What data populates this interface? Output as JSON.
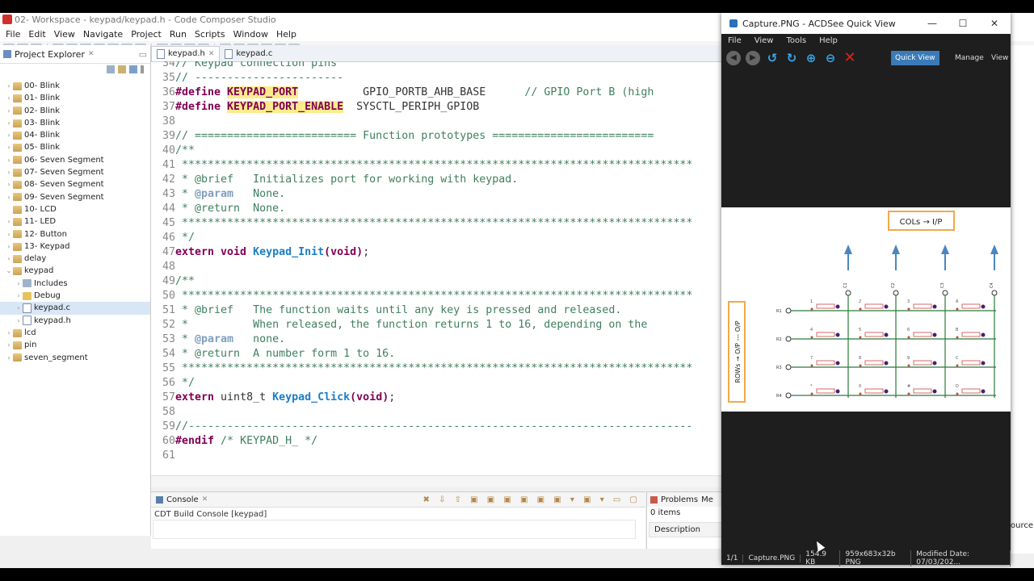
{
  "ccs": {
    "title": "02- Workspace - keypad/keypad.h - Code Composer Studio",
    "menu": [
      "File",
      "Edit",
      "View",
      "Navigate",
      "Project",
      "Run",
      "Scripts",
      "Window",
      "Help"
    ]
  },
  "project_explorer": {
    "title": "Project Explorer",
    "items": [
      {
        "label": "00- Blink",
        "kind": "proj",
        "indent": 0,
        "arrow": ">"
      },
      {
        "label": "01- Blink",
        "kind": "proj",
        "indent": 0,
        "arrow": ">"
      },
      {
        "label": "02- Blink",
        "kind": "proj",
        "indent": 0,
        "arrow": ">"
      },
      {
        "label": "03- Blink",
        "kind": "proj",
        "indent": 0,
        "arrow": ">"
      },
      {
        "label": "04- Blink",
        "kind": "proj",
        "indent": 0,
        "arrow": ">"
      },
      {
        "label": "05- Blink",
        "kind": "proj",
        "indent": 0,
        "arrow": ">"
      },
      {
        "label": "06- Seven Segment",
        "kind": "proj",
        "indent": 0,
        "arrow": ">"
      },
      {
        "label": "07- Seven Segment",
        "kind": "proj",
        "indent": 0,
        "arrow": ">"
      },
      {
        "label": "08- Seven Segment",
        "kind": "proj",
        "indent": 0,
        "arrow": ">"
      },
      {
        "label": "09- Seven Segment",
        "kind": "proj",
        "indent": 0,
        "arrow": ">"
      },
      {
        "label": "10- LCD",
        "kind": "proj",
        "indent": 0,
        "arrow": ""
      },
      {
        "label": "11- LED",
        "kind": "proj",
        "indent": 0,
        "arrow": ">"
      },
      {
        "label": "12- Button",
        "kind": "proj",
        "indent": 0,
        "arrow": ">"
      },
      {
        "label": "13- Keypad",
        "kind": "proj",
        "indent": 0,
        "arrow": ">"
      },
      {
        "label": "delay",
        "kind": "proj",
        "indent": 0,
        "arrow": ">"
      },
      {
        "label": "keypad",
        "kind": "proj",
        "indent": 0,
        "arrow": "v"
      },
      {
        "label": "Includes",
        "kind": "inc",
        "indent": 1,
        "arrow": ">"
      },
      {
        "label": "Debug",
        "kind": "folder",
        "indent": 1,
        "arrow": ">"
      },
      {
        "label": "keypad.c",
        "kind": "file",
        "indent": 1,
        "arrow": ">",
        "selected": true
      },
      {
        "label": "keypad.h",
        "kind": "file",
        "indent": 1,
        "arrow": ">"
      },
      {
        "label": "lcd",
        "kind": "proj",
        "indent": 0,
        "arrow": ">"
      },
      {
        "label": "pin",
        "kind": "proj",
        "indent": 0,
        "arrow": ">"
      },
      {
        "label": "seven_segment",
        "kind": "proj",
        "indent": 0,
        "arrow": ">"
      }
    ]
  },
  "editor": {
    "tabs": [
      {
        "label": "keypad.h",
        "active": true
      },
      {
        "label": "keypad.c",
        "active": false
      }
    ]
  },
  "console": {
    "title": "Console",
    "subtitle": "CDT Build Console [keypad]"
  },
  "problems": {
    "title": "Problems",
    "extra": "Me",
    "items": "0 items",
    "column": "Description"
  },
  "right_edge": {
    "text": "ource"
  },
  "acdsee": {
    "title": "Capture.PNG - ACDSee Quick View",
    "menu": [
      "File",
      "View",
      "Tools",
      "Help"
    ],
    "modes": [
      "Quick View",
      "Manage",
      "View"
    ],
    "image": {
      "cols_label": "COLs → I/P",
      "rows_label": "ROWs → O/P --- O/P",
      "row_names": [
        "R1",
        "R2",
        "R3",
        "R4"
      ],
      "col_names": [
        "C1",
        "C2",
        "C3",
        "C4"
      ],
      "keys": [
        "1",
        "2",
        "3",
        "A",
        "4",
        "5",
        "6",
        "B",
        "7",
        "8",
        "9",
        "C",
        "*",
        "0",
        "#",
        "D"
      ]
    },
    "status": [
      "1/1",
      "Capture.PNG",
      "154.9 KB",
      "959x683x32b PNG",
      "Modified Date: 07/03/202..."
    ]
  },
  "code_lines": [
    {
      "n": "34",
      "segs": [
        [
          "cmt",
          "// Keypad connection pins"
        ]
      ]
    },
    {
      "n": "35",
      "segs": [
        [
          "cmt",
          "// -----------------------"
        ]
      ]
    },
    {
      "n": "36",
      "segs": [
        [
          "dir",
          "#define "
        ],
        [
          "mac hl",
          "KEYPAD_PORT"
        ],
        [
          "plain",
          "          GPIO_PORTB_AHB_BASE      "
        ],
        [
          "cmt",
          "// GPIO Port B (high"
        ]
      ]
    },
    {
      "n": "37",
      "segs": [
        [
          "dir",
          "#define "
        ],
        [
          "mac hl",
          "KEYPAD_PORT_ENABLE"
        ],
        [
          "plain",
          "  SYSCTL_PERIPH_GPIOB"
        ]
      ]
    },
    {
      "n": "38",
      "segs": []
    },
    {
      "n": "39",
      "segs": [
        [
          "cmt",
          "// ========================= Function prototypes ========================="
        ]
      ]
    },
    {
      "n": "40",
      "segs": [
        [
          "cmt",
          "/**"
        ]
      ]
    },
    {
      "n": "41",
      "segs": [
        [
          "cmt",
          " *******************************************************************************"
        ]
      ]
    },
    {
      "n": "42",
      "segs": [
        [
          "cmt",
          " * @brief   Initializes port for working with keypad."
        ]
      ]
    },
    {
      "n": "43",
      "segs": [
        [
          "cmt",
          " * "
        ],
        [
          "doctag",
          "@param"
        ],
        [
          "cmt",
          "   None."
        ]
      ]
    },
    {
      "n": "44",
      "segs": [
        [
          "cmt",
          " * @return  None."
        ]
      ]
    },
    {
      "n": "45",
      "segs": [
        [
          "cmt",
          " *******************************************************************************"
        ]
      ]
    },
    {
      "n": "46",
      "segs": [
        [
          "cmt",
          " */"
        ]
      ]
    },
    {
      "n": "47",
      "segs": [
        [
          "kw",
          "extern void "
        ],
        [
          "fn",
          "Keypad_Init"
        ],
        [
          "kw",
          "(void)"
        ],
        [
          "plain",
          ";"
        ]
      ]
    },
    {
      "n": "48",
      "segs": []
    },
    {
      "n": "49",
      "segs": [
        [
          "cmt",
          "/**"
        ]
      ]
    },
    {
      "n": "50",
      "segs": [
        [
          "cmt",
          " *******************************************************************************"
        ]
      ]
    },
    {
      "n": "51",
      "segs": [
        [
          "cmt",
          " * @brief   The function waits until any key is pressed and released."
        ]
      ]
    },
    {
      "n": "52",
      "segs": [
        [
          "cmt",
          " *          When released, the function returns 1 to 16, depending on the"
        ]
      ]
    },
    {
      "n": "53",
      "segs": [
        [
          "cmt",
          " * "
        ],
        [
          "doctag",
          "@param"
        ],
        [
          "cmt",
          "   none."
        ]
      ]
    },
    {
      "n": "54",
      "segs": [
        [
          "cmt",
          " * @return  A number form 1 to 16."
        ]
      ]
    },
    {
      "n": "55",
      "segs": [
        [
          "cmt",
          " *******************************************************************************"
        ]
      ]
    },
    {
      "n": "56",
      "segs": [
        [
          "cmt",
          " */"
        ]
      ]
    },
    {
      "n": "57",
      "segs": [
        [
          "kw",
          "extern "
        ],
        [
          "plain",
          "uint8_t "
        ],
        [
          "fn",
          "Keypad_Click"
        ],
        [
          "kw",
          "(void)"
        ],
        [
          "plain",
          ";"
        ]
      ]
    },
    {
      "n": "58",
      "segs": []
    },
    {
      "n": "59",
      "segs": [
        [
          "cmt",
          "//------------------------------------------------------------------------------"
        ]
      ]
    },
    {
      "n": "60",
      "segs": [
        [
          "dir",
          "#endif "
        ],
        [
          "cmt",
          "/* KEYPAD_H_ */"
        ]
      ]
    },
    {
      "n": "61",
      "segs": []
    }
  ]
}
